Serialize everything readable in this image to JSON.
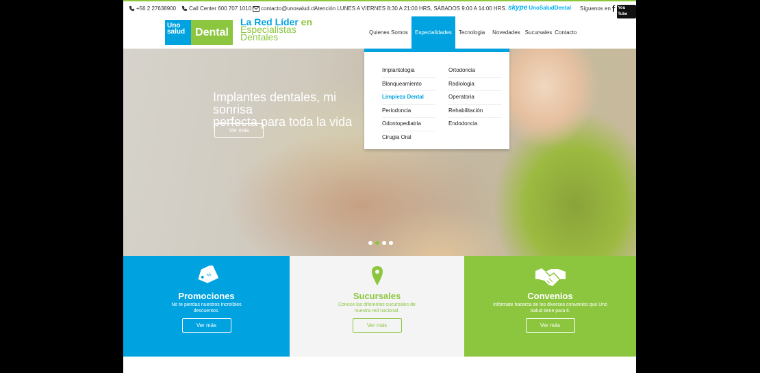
{
  "topbar": {
    "phone": "+56 2 27638900",
    "call_center": "Call Center 600 707 1010",
    "email": "contacto@unosalud.cl",
    "hours": "Atención LUNES A VIERNES 8:30 A 21:00 HRS, SÁBADOS 9:00 A 14:00 HRS.",
    "skype_logo": "skype",
    "skype_name": "UnoSaludDental",
    "follow": "Síguenos en",
    "facebook": "f",
    "youtube": "You Tube"
  },
  "logo": {
    "uno": "Uno",
    "salud": "salud",
    "dental": "Dental"
  },
  "tagline": {
    "line1_a": "La Red Líder",
    "line1_b": " en",
    "line2": "Especialistas",
    "line3": "Dentales"
  },
  "nav": {
    "items": [
      "Quienes Somos",
      "Especialidades",
      "Tecnologia",
      "Novedades",
      "Sucursales",
      "Contacto"
    ],
    "active": "Especialidades"
  },
  "dropdown": {
    "col1": [
      "Implantologia",
      "Blanqueamiento",
      "Limpieza Dental",
      "Periodoncia",
      "Odontopediatria",
      "Cirugia Oral"
    ],
    "col2": [
      "Ortodoncia",
      "Radiologia",
      "Operatoria",
      "Rehabilitación",
      "Endodoncia"
    ],
    "highlighted": "Limpieza Dental"
  },
  "hero": {
    "title": "Implantes dentales, mi sonrisa\nperfecta para toda la vida",
    "button": "Ver más",
    "slides": 4,
    "active_slide": 2
  },
  "panels": [
    {
      "title": "Promociones",
      "desc": "No te pierdas nuestros increíbles descuentos.",
      "button": "Ver más",
      "icon": "price-tag-icon",
      "color": "#00a3e0"
    },
    {
      "title": "Sucursales",
      "desc": "Conoce las diferentes sucursales de nuestra red nacional.",
      "button": "Ver más",
      "icon": "map-pin-icon",
      "color": "#f4f4f4"
    },
    {
      "title": "Convenios",
      "desc": "Infórmate hacerca de los diversos convenios que Uno Salud tiene para ti.",
      "button": "Ver más",
      "icon": "handshake-icon",
      "color": "#8cc63f"
    }
  ],
  "colors": {
    "brand_blue": "#00a3e0",
    "brand_green": "#8cc63f"
  }
}
